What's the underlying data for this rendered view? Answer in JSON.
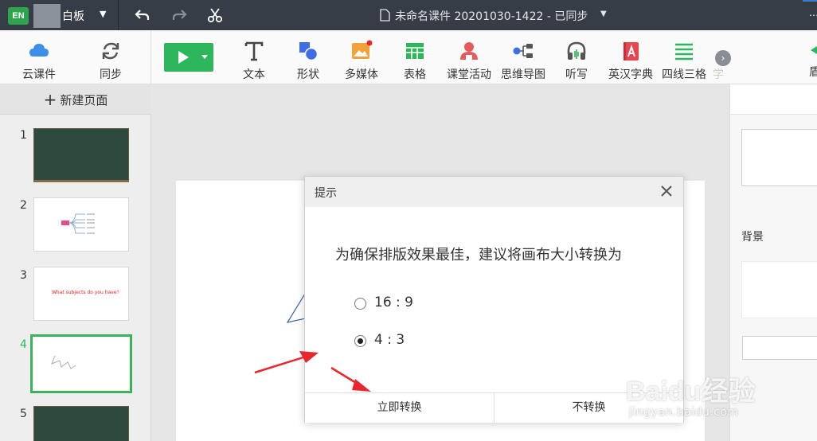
{
  "titlebar": {
    "logo_text": "EN",
    "app_name": "白板",
    "document_title": "未命名课件 20201030-1422 - 已同步"
  },
  "toolbar": {
    "items": [
      {
        "label": "云课件",
        "icon": "cloud-icon"
      },
      {
        "label": "同步",
        "icon": "sync-icon"
      },
      {
        "label": "文本",
        "icon": "text-icon"
      },
      {
        "label": "形状",
        "icon": "shape-icon"
      },
      {
        "label": "多媒体",
        "icon": "image-icon"
      },
      {
        "label": "表格",
        "icon": "table-icon"
      },
      {
        "label": "课堂活动",
        "icon": "class-activity-icon"
      },
      {
        "label": "思维导图",
        "icon": "mindmap-icon"
      },
      {
        "label": "听写",
        "icon": "headphones-icon"
      },
      {
        "label": "英汉字典",
        "icon": "dictionary-icon"
      },
      {
        "label": "四线三格",
        "icon": "four-lines-icon"
      }
    ],
    "cut_off_label": "学",
    "right_cut_label": "盾"
  },
  "left_panel": {
    "new_page_label": "新建页面",
    "slides": [
      {
        "number": "1",
        "type": "blackboard"
      },
      {
        "number": "2",
        "type": "mindmap"
      },
      {
        "number": "3",
        "type": "text",
        "text": "What subjects do you have?"
      },
      {
        "number": "4",
        "type": "drawing",
        "active": true
      },
      {
        "number": "5",
        "type": "blackboard"
      }
    ]
  },
  "right_panel": {
    "background_label": "背景"
  },
  "dialog": {
    "title": "提示",
    "message": "为确保排版效果最佳，建议将画布大小转换为",
    "options": [
      {
        "label": "16 : 9",
        "checked": false
      },
      {
        "label": "4 : 3",
        "checked": true
      }
    ],
    "confirm_label": "立即转换",
    "cancel_label": "不转换"
  },
  "watermark": {
    "brand": "Baidu经验",
    "url": "jingyan.baidu.com"
  },
  "colors": {
    "titlebar": "#373d47",
    "accent_green": "#2db65b",
    "annotation_red": "#e8262b"
  }
}
